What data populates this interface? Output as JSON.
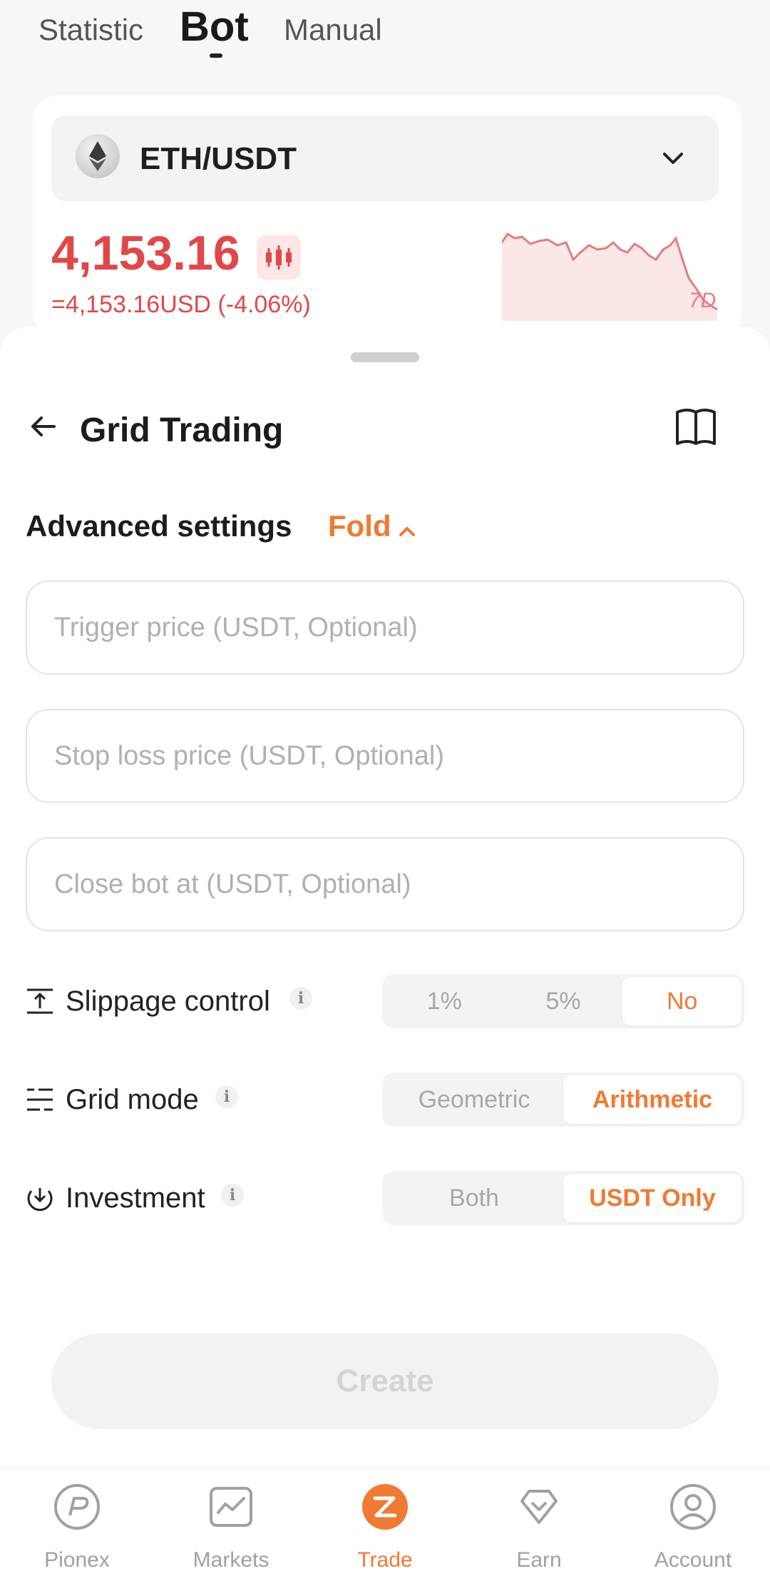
{
  "top_tabs": [
    {
      "label": "Statistic",
      "active": false
    },
    {
      "label": "Bot",
      "active": true
    },
    {
      "label": "Manual",
      "active": false
    }
  ],
  "pair": {
    "name": "ETH/USDT",
    "price": "4,153.16",
    "usd_value": "=4,153.16USD (-4.06%)",
    "chart_period": "7D",
    "icon": "ethereum-icon",
    "color": "#e04848"
  },
  "sheet": {
    "title": "Grid Trading",
    "back_icon": "arrow-left-icon",
    "guide_icon": "book-icon",
    "advanced_label": "Advanced settings",
    "fold_label": "Fold"
  },
  "fields": {
    "trigger_price": {
      "placeholder": "Trigger price (USDT, Optional)",
      "value": ""
    },
    "stop_loss": {
      "placeholder": "Stop loss price (USDT, Optional)",
      "value": ""
    },
    "close_bot": {
      "placeholder": "Close bot at (USDT, Optional)",
      "value": ""
    }
  },
  "options": {
    "slippage": {
      "label": "Slippage control",
      "items": [
        "1%",
        "5%",
        "No"
      ],
      "selected": "No"
    },
    "grid_mode": {
      "label": "Grid mode",
      "items": [
        "Geometric",
        "Arithmetic"
      ],
      "selected": "Arithmetic"
    },
    "investment": {
      "label": "Investment",
      "items": [
        "Both",
        "USDT Only"
      ],
      "selected": "USDT Only"
    }
  },
  "create_label": "Create",
  "nav": [
    {
      "label": "Pionex",
      "icon": "pionex-icon",
      "active": false
    },
    {
      "label": "Markets",
      "icon": "markets-icon",
      "active": false
    },
    {
      "label": "Trade",
      "icon": "trade-icon",
      "active": true
    },
    {
      "label": "Earn",
      "icon": "earn-icon",
      "active": false
    },
    {
      "label": "Account",
      "icon": "account-icon",
      "active": false
    }
  ],
  "colors": {
    "accent": "#f07a32",
    "down": "#e04848"
  }
}
